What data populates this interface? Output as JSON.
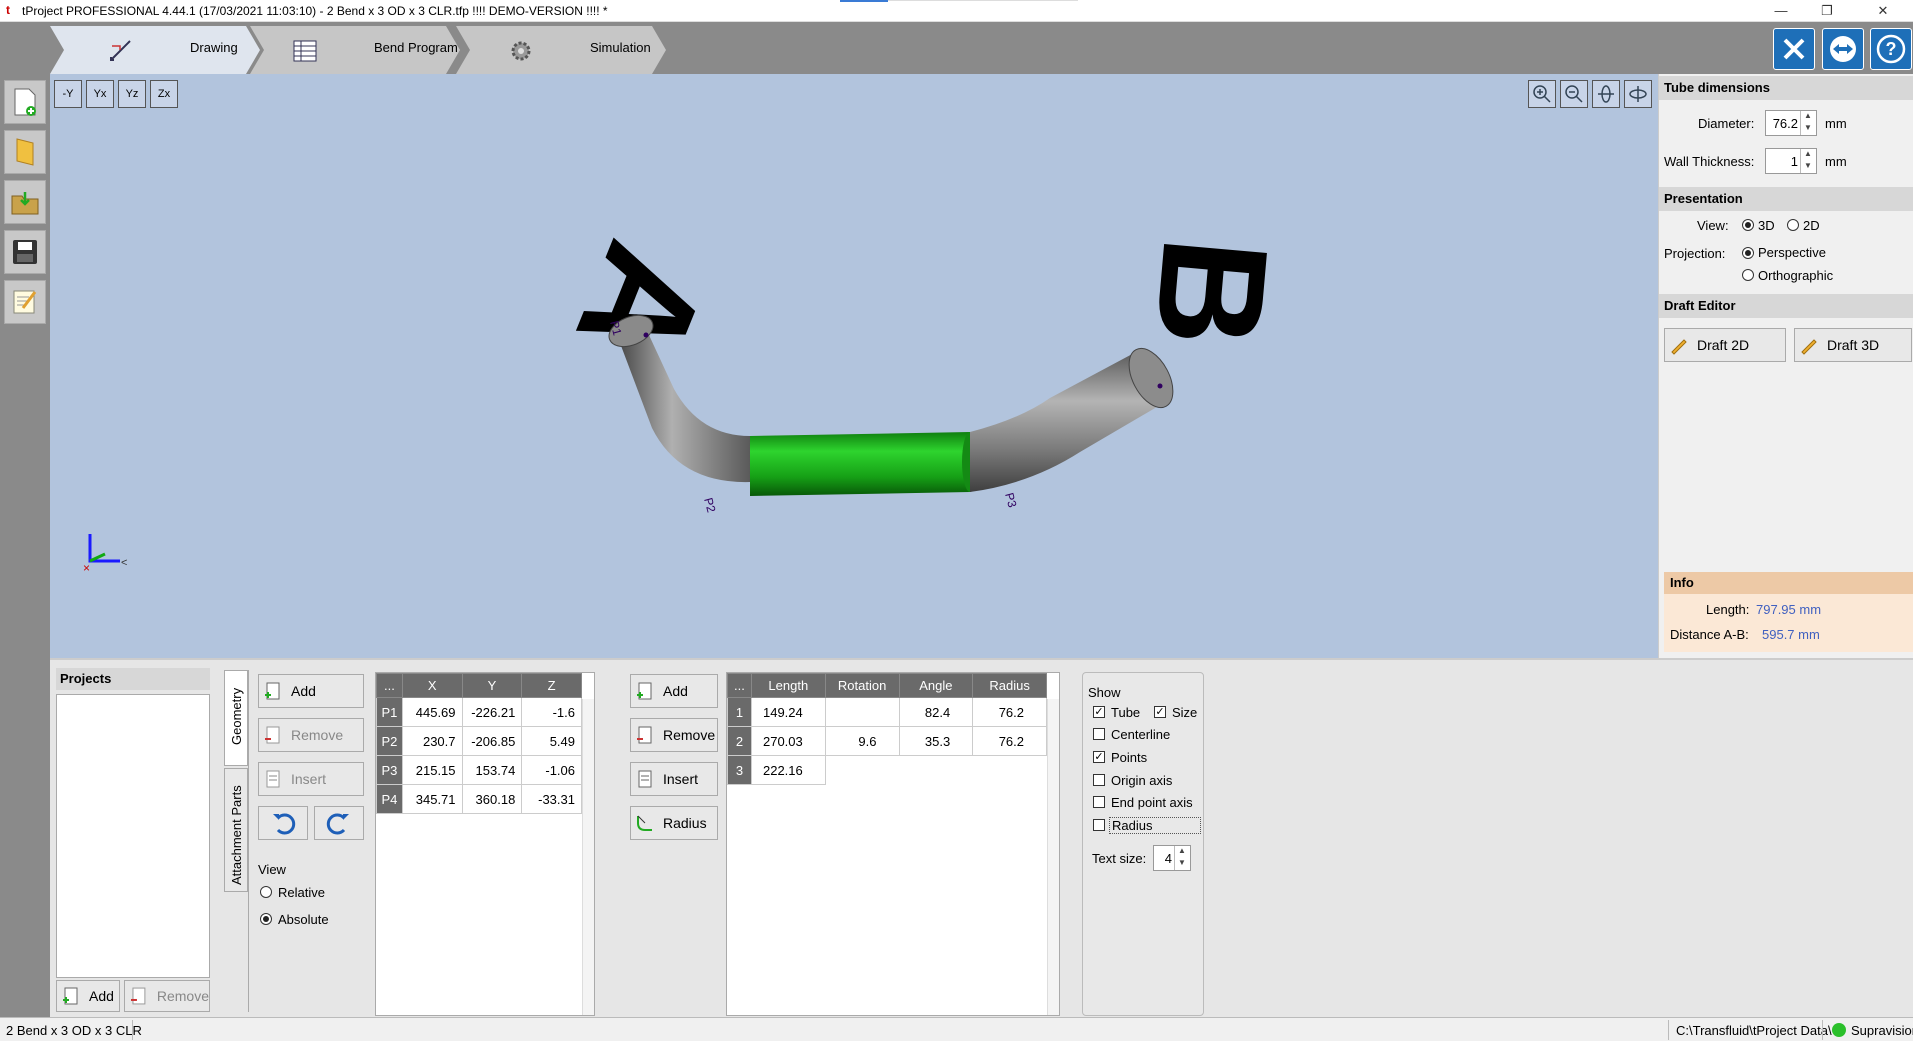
{
  "window": {
    "title": "tProject PROFESSIONAL 4.44.1 (17/03/2021 11:03:10) - 2 Bend x 3 OD x 3 CLR.tfp !!!! DEMO-VERSION !!!! *",
    "minimize": "—",
    "restore": "❐",
    "close": "✕"
  },
  "tabs": [
    {
      "label": "Drawing",
      "icon": "drawing-icon",
      "active": true
    },
    {
      "label": "Bend Program",
      "icon": "table-icon"
    },
    {
      "label": "Simulation",
      "icon": "gear-icon"
    }
  ],
  "viewport": {
    "label_a": "A",
    "label_b": "B",
    "point_labels": [
      "P1",
      "P2",
      "P3"
    ],
    "axis_buttons": [
      "-Y",
      "Yx",
      "Yz",
      "Zx"
    ],
    "colors": {
      "background": "#b2c4dd",
      "tube": "#8c8c8c",
      "highlight": "#22b822"
    }
  },
  "right_panel": {
    "tube_dimensions": {
      "header": "Tube dimensions",
      "diameter_label": "Diameter:",
      "diameter_value": "76.2",
      "wall_label": "Wall Thickness:",
      "wall_value": "1",
      "unit": "mm"
    },
    "presentation": {
      "header": "Presentation",
      "view_label": "View:",
      "view_3d": "3D",
      "view_2d": "2D",
      "projection_label": "Projection:",
      "perspective": "Perspective",
      "orthographic": "Orthographic"
    },
    "draft_editor": {
      "header": "Draft Editor",
      "draft2d": "Draft 2D",
      "draft3d": "Draft 3D"
    },
    "info": {
      "header": "Info",
      "length_label": "Length:",
      "length_value": "797.95 mm",
      "distance_label": "Distance A-B:",
      "distance_value": "595.7 mm"
    }
  },
  "projects": {
    "header": "Projects",
    "add": "Add",
    "remove": "Remove"
  },
  "side_tabs": {
    "geometry": "Geometry",
    "attachment": "Attachment Parts"
  },
  "points_buttons": {
    "add": "Add",
    "remove": "Remove",
    "insert": "Insert"
  },
  "view_options": {
    "header": "View",
    "relative": "Relative",
    "absolute": "Absolute"
  },
  "points_table": {
    "headers": [
      "...",
      "X",
      "Y",
      "Z"
    ],
    "rows": [
      {
        "id": "P1",
        "x": "445.69",
        "y": "-226.21",
        "z": "-1.6"
      },
      {
        "id": "P2",
        "x": "230.7",
        "y": "-206.85",
        "z": "5.49"
      },
      {
        "id": "P3",
        "x": "215.15",
        "y": "153.74",
        "z": "-1.06"
      },
      {
        "id": "P4",
        "x": "345.71",
        "y": "360.18",
        "z": "-33.31"
      }
    ]
  },
  "segment_buttons": {
    "add": "Add",
    "remove": "Remove",
    "insert": "Insert",
    "radius": "Radius"
  },
  "segments_table": {
    "headers": [
      "...",
      "Length",
      "Rotation",
      "Angle",
      "Radius"
    ],
    "rows": [
      {
        "id": "1",
        "length": "149.24",
        "rotation": "",
        "angle": "82.4",
        "radius": "76.2"
      },
      {
        "id": "2",
        "length": "270.03",
        "rotation": "9.6",
        "angle": "35.3",
        "radius": "76.2"
      },
      {
        "id": "3",
        "length": "222.16",
        "rotation": "",
        "angle": "",
        "radius": ""
      }
    ]
  },
  "show": {
    "header": "Show",
    "tube": "Tube",
    "size": "Size",
    "centerline": "Centerline",
    "points": "Points",
    "origin_axis": "Origin axis",
    "end_point_axis": "End point axis",
    "radius": "Radius",
    "text_size_label": "Text size:",
    "text_size_value": "4"
  },
  "status": {
    "project": "2 Bend x 3 OD x 3 CLR",
    "path": "C:\\Transfluid\\tProject Data\\",
    "supravision": "Supravision"
  }
}
